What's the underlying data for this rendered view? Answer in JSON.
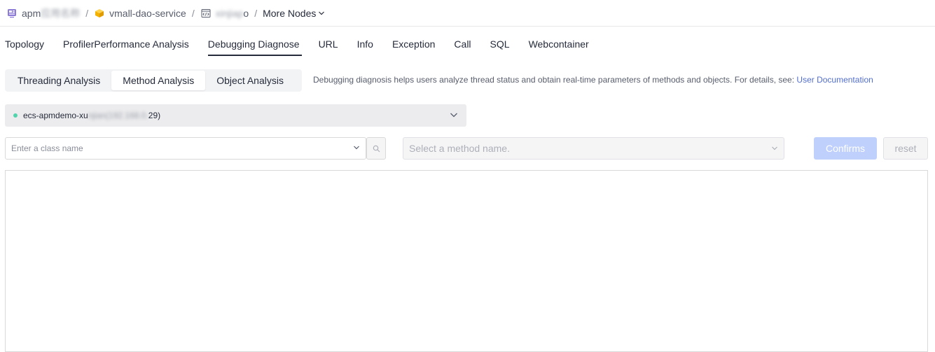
{
  "breadcrumb": {
    "app_prefix": "apm",
    "app_masked": "应用名称",
    "service": "vmall-dao-service",
    "env_masked": "xinjiap",
    "env_suffix": "o",
    "more_nodes": "More Nodes",
    "separator": "/"
  },
  "tabs": [
    {
      "label": "Topology"
    },
    {
      "label": "ProfilerPerformance Analysis"
    },
    {
      "label": "Debugging Diagnose"
    },
    {
      "label": "URL"
    },
    {
      "label": "Info"
    },
    {
      "label": "Exception"
    },
    {
      "label": "Call"
    },
    {
      "label": "SQL"
    },
    {
      "label": "Webcontainer"
    }
  ],
  "active_tab": "Debugging Diagnose",
  "segments": [
    {
      "label": "Threading Analysis"
    },
    {
      "label": "Method Analysis"
    },
    {
      "label": "Object Analysis"
    }
  ],
  "active_segment": "Method Analysis",
  "hint": {
    "text": "Debugging diagnosis helps users analyze thread status and obtain real-time parameters of methods and objects. For details, see: ",
    "link": "User Documentation"
  },
  "node_select": {
    "prefix": "ecs-apmdemo-xu",
    "masked": "njian(192.168.0.",
    "suffix": "29)",
    "status_color": "#50d4ab"
  },
  "class_input": {
    "placeholder": "Enter a class name"
  },
  "method_select": {
    "placeholder": "Select a method name."
  },
  "buttons": {
    "confirm": "Confirms",
    "reset": "reset"
  },
  "icons": {
    "app": "app-icon",
    "service": "cube-icon",
    "env": "code-window-icon",
    "search": "search-icon",
    "chevron": "chevron-down-icon"
  },
  "colors": {
    "accent": "#526ecc",
    "confirm_disabled": "#bed0fb",
    "app_icon": "#8e7bd8",
    "service_icon": "#f5b100"
  }
}
